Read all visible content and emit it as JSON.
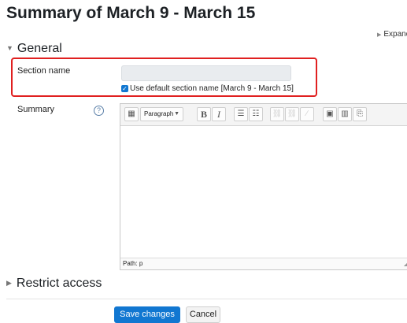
{
  "page": {
    "title": "Summary of March 9 - March 15",
    "expand_all": "Expand a"
  },
  "general": {
    "header": "General",
    "section_name_label": "Section name",
    "section_name_value": "",
    "use_default_label": "Use default section name [March 9 - March 15]",
    "use_default_checked": true,
    "summary_label": "Summary",
    "help_glyph": "?"
  },
  "editor": {
    "format_select": "Paragraph",
    "toolbar": [
      {
        "icon": "toggle-toolbar-icon",
        "glyph": "▦",
        "enabled": true
      },
      {
        "icon": "bold-icon",
        "glyph": "B",
        "enabled": true
      },
      {
        "icon": "italic-icon",
        "glyph": "I",
        "enabled": true
      },
      {
        "icon": "bullet-list-icon",
        "glyph": "☰",
        "enabled": true
      },
      {
        "icon": "numbered-list-icon",
        "glyph": "☷",
        "enabled": true
      },
      {
        "icon": "link-icon",
        "glyph": "⛓",
        "enabled": false
      },
      {
        "icon": "unlink-icon",
        "glyph": "⛓",
        "enabled": false
      },
      {
        "icon": "disabled-icon",
        "glyph": "∕",
        "enabled": false
      },
      {
        "icon": "image-icon",
        "glyph": "▣",
        "enabled": true
      },
      {
        "icon": "media-icon",
        "glyph": "▥",
        "enabled": true
      },
      {
        "icon": "paste-icon",
        "glyph": "⎘",
        "enabled": true
      }
    ],
    "content": "",
    "path": "Path: p"
  },
  "restrict": {
    "header": "Restrict access"
  },
  "buttons": {
    "save": "Save changes",
    "cancel": "Cancel"
  },
  "colors": {
    "primary": "#1177d1",
    "highlight": "#e02020"
  }
}
